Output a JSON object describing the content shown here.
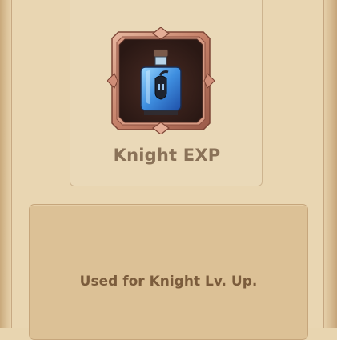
{
  "item": {
    "name": "Knight EXP",
    "description": "Used for Knight Lv. Up.",
    "icon": "knight-exp-potion-icon"
  },
  "colors": {
    "background": "#e9d6b2",
    "card": "#ead9b8",
    "panel": "#dcc196",
    "frame_copper": "#c98a73",
    "frame_dark": "#3a221c",
    "text_name": "#8a7258",
    "text_desc": "#7b5c3c"
  }
}
